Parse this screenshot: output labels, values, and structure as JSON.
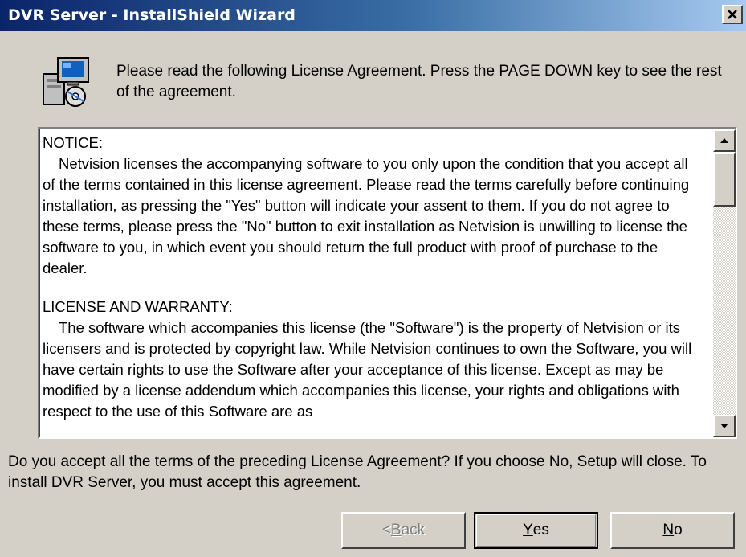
{
  "window": {
    "title": "DVR Server - InstallShield Wizard"
  },
  "header": {
    "icon": "setup-computer-icon",
    "instruction": "Please read the following License Agreement.  Press the PAGE DOWN key to see the rest of the agreement."
  },
  "license": {
    "notice_heading": "NOTICE:",
    "notice_body": "Netvision licenses the accompanying software to you only upon the condition that you accept all of the terms contained in this license agreement. Please read the terms carefully before continuing installation, as pressing the \"Yes\" button will indicate your assent to them.  If you do not agree to these terms, please press the \"No\" button to exit installation as Netvision is unwilling to license the software to you, in which event you should return the full product with proof of purchase to the dealer.",
    "warranty_heading": "LICENSE AND WARRANTY:",
    "warranty_body": "The software which accompanies this license (the \"Software\") is the property of Netvision or its licensers and is protected by copyright law. While Netvision continues to own the Software, you will have certain rights to use the Software after your acceptance of this license.  Except as may be modified by a license addendum which accompanies this license, your rights and obligations with respect to the use of this Software are as"
  },
  "question": "Do you accept all the terms of the preceding License Agreement?  If you choose No,  Setup will close.  To install DVR Server, you must accept this agreement.",
  "buttons": {
    "back_prefix": "< ",
    "back_mnemonic": "B",
    "back_rest": "ack",
    "yes_mnemonic": "Y",
    "yes_rest": "es",
    "no_mnemonic": "N",
    "no_rest": "o"
  },
  "colors": {
    "titlebar_start": "#0a246a",
    "titlebar_end": "#a6caf0",
    "dialog_face": "#d4d0c8"
  }
}
